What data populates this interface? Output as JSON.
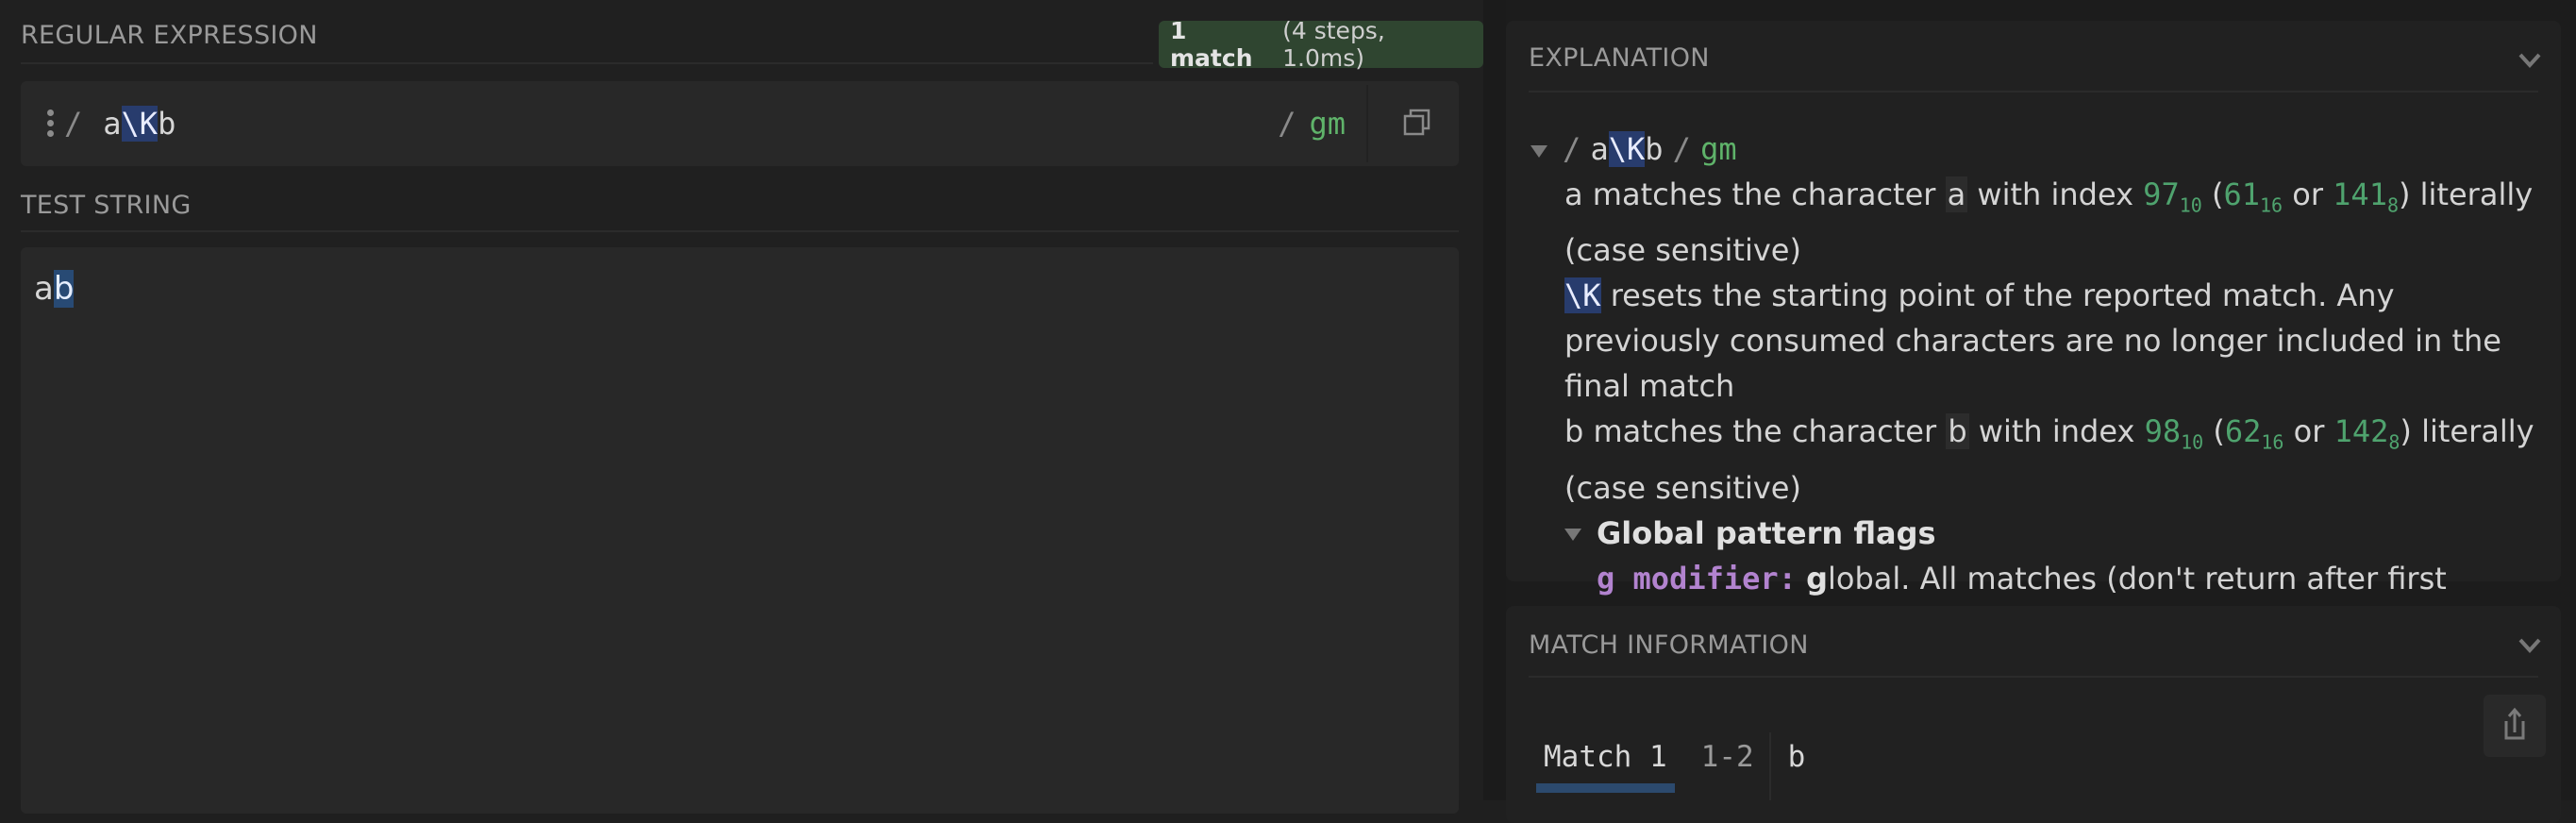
{
  "regex": {
    "section_title": "REGULAR EXPRESSION",
    "match_badge": {
      "count_label": "1 match",
      "details": "(4 steps, 1.0ms)"
    },
    "delimiter": "/",
    "pattern_tokens": [
      "a",
      "\\K",
      "b"
    ],
    "flags": "gm",
    "copy_icon": "copy-icon",
    "handle_icon": "drag-handle-icon"
  },
  "test_string": {
    "section_title": "TEST STRING",
    "unmatched": "a",
    "matched": "b"
  },
  "explanation": {
    "section_title": "EXPLANATION",
    "root": {
      "open": "/",
      "tokens": [
        "a",
        "\\K",
        "b"
      ],
      "close": "/",
      "flags": "gm"
    },
    "items": [
      {
        "token": "a",
        "pre": "matches the character",
        "char": "a",
        "mid": "with index",
        "dec": "97",
        "dec_base": "10",
        "hex": "61",
        "hex_base": "16",
        "or": "or",
        "oct": "141",
        "oct_base": "8",
        "post": ") literally (case sensitive)"
      },
      {
        "token": "\\K",
        "text": "resets the starting point of the reported match. Any previously consumed characters are no longer included in the final match"
      },
      {
        "token": "b",
        "pre": "matches the character",
        "char": "b",
        "mid": "with index",
        "dec": "98",
        "dec_base": "10",
        "hex": "62",
        "hex_base": "16",
        "or": "or",
        "oct": "142",
        "oct_base": "8",
        "post": ") literally (case sensitive)"
      }
    ],
    "flags_group": {
      "title": "Global pattern flags",
      "modifier_label": "g modifier:",
      "modifier_lead": "g",
      "modifier_text": "lobal. All matches (don't return after first"
    }
  },
  "match_information": {
    "section_title": "MATCH INFORMATION",
    "tab_label": "Match 1",
    "range": "1-2",
    "value": "b",
    "share_icon": "share-icon"
  },
  "colors": {
    "accent_green": "#5fb36a",
    "escape_highlight": "#283c6d",
    "match_highlight": "#284a74",
    "modifier_purple": "#b283cf"
  }
}
